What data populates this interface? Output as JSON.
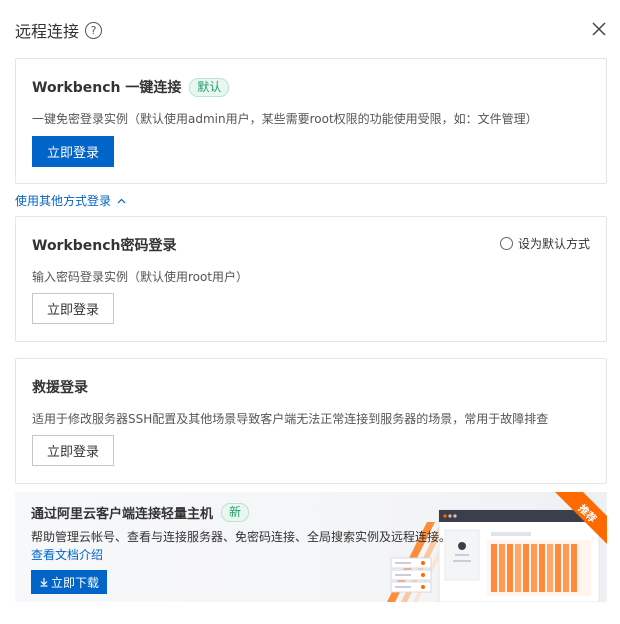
{
  "header": {
    "title": "远程连接",
    "help_icon_glyph": "?"
  },
  "cards": [
    {
      "title": "Workbench 一键连接",
      "tag": "默认",
      "description": "一键免密登录实例（默认使用admin用户，某些需要root权限的功能使用受限，如：文件管理）",
      "button": "立即登录"
    },
    {
      "title": "Workbench密码登录",
      "radio_label": "设为默认方式",
      "description": "输入密码登录实例（默认使用root用户）",
      "button": "立即登录"
    },
    {
      "title": "救援登录",
      "description": "适用于修改服务器SSH配置及其他场景导致客户端无法正常连接到服务器的场景，常用于故障排查",
      "button": "立即登录"
    }
  ],
  "other_methods_link": "使用其他方式登录",
  "promo": {
    "title": "通过阿里云客户端连接轻量主机",
    "tag": "新",
    "description": "帮助管理云帐号、查看与连接服务器、免密码连接、全局搜索实例及远程连接。",
    "link": "查看文档介绍",
    "button": "立即下载",
    "ribbon": "推荐"
  },
  "colors": {
    "primary": "#0064c8",
    "tag_green": "#22a06b",
    "ribbon_orange": "#ff6a00"
  }
}
